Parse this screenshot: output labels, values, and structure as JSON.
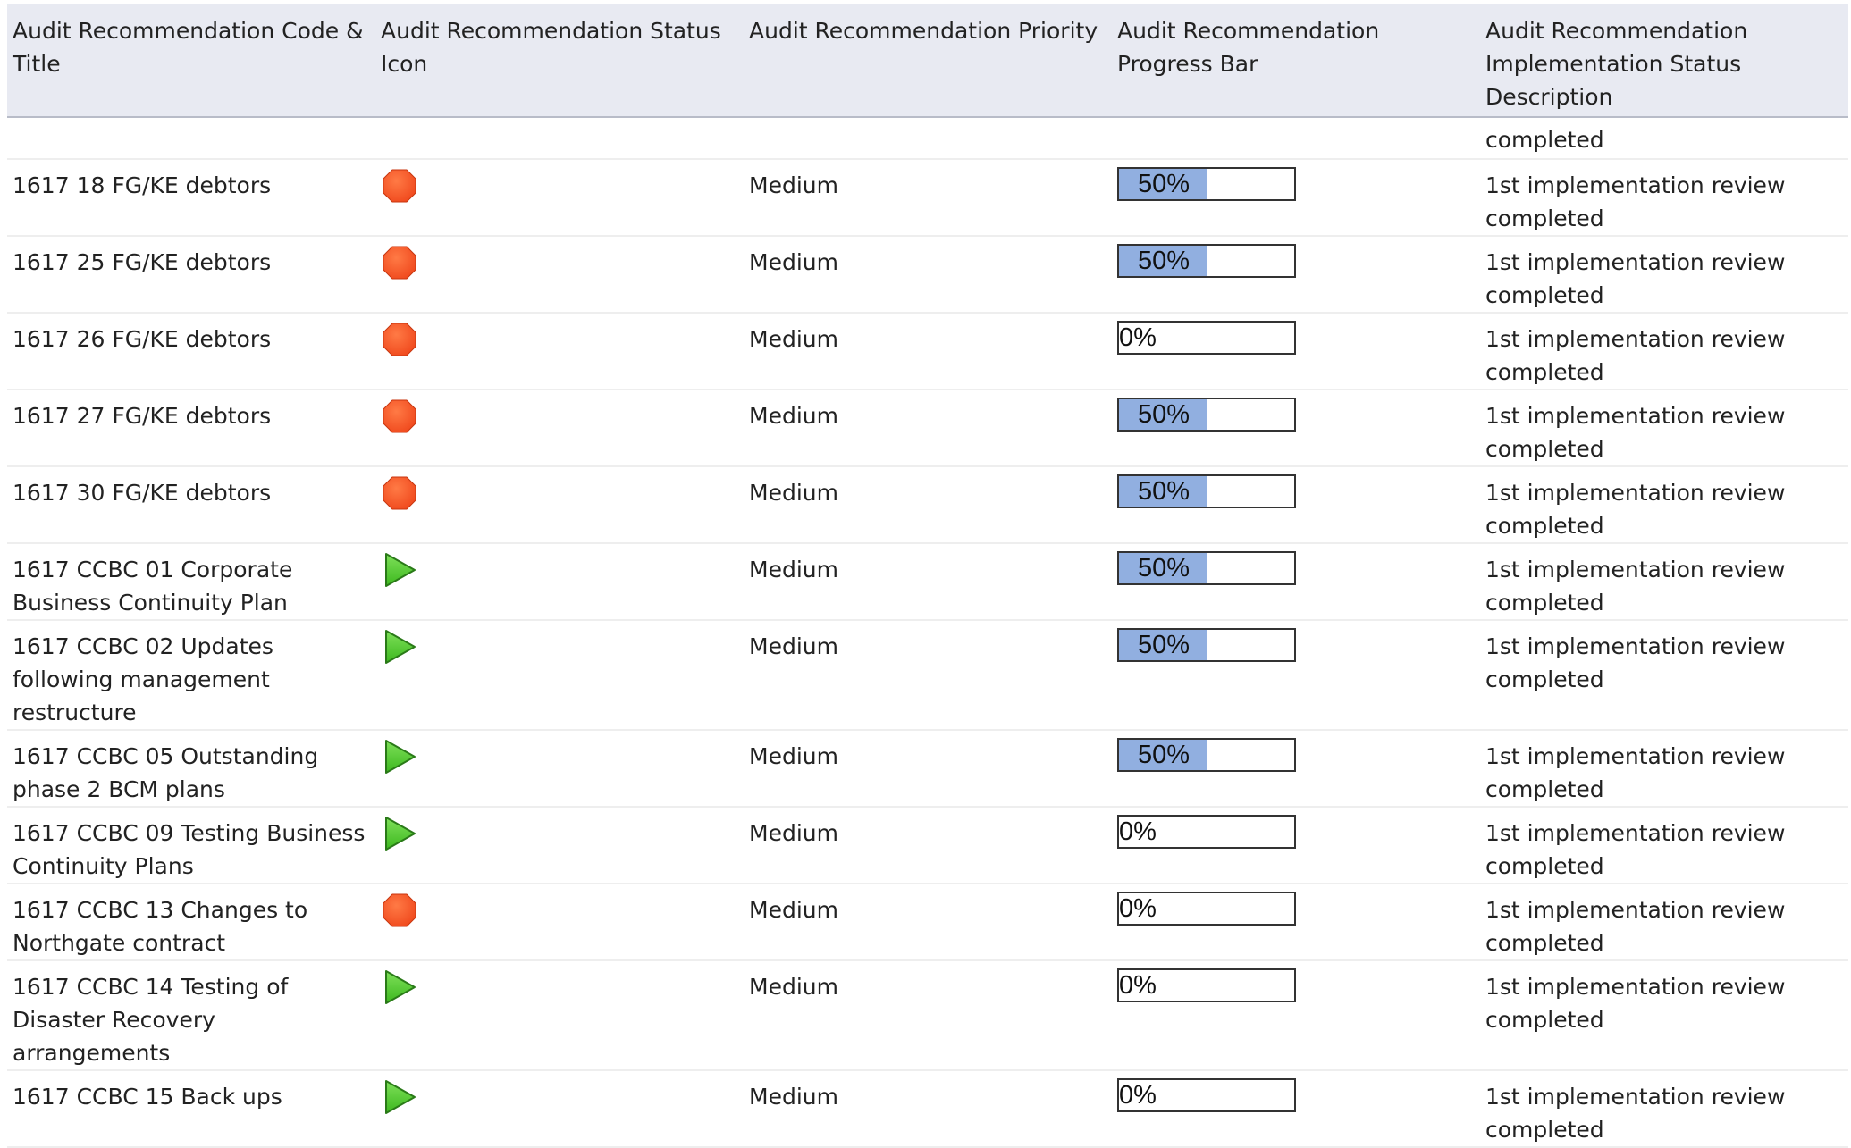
{
  "table": {
    "headers": [
      "Audit Recommendation Code & Title",
      "Audit Recommendation Status Icon",
      "Audit Recommendation Priority",
      "Audit Recommendation Progress Bar",
      "Audit Recommendation Implementation Status Description"
    ],
    "partial_row_description": "completed",
    "rows": [
      {
        "title": "1617 18 FG/KE debtors",
        "status_icon": "red-octagon-icon",
        "priority": "Medium",
        "progress": 50,
        "progress_label": "50%",
        "description": "1st implementation review completed"
      },
      {
        "title": "1617 25 FG/KE debtors",
        "status_icon": "red-octagon-icon",
        "priority": "Medium",
        "progress": 50,
        "progress_label": "50%",
        "description": "1st implementation review completed"
      },
      {
        "title": "1617 26 FG/KE debtors",
        "status_icon": "red-octagon-icon",
        "priority": "Medium",
        "progress": 0,
        "progress_label": "0%",
        "description": "1st implementation review completed"
      },
      {
        "title": "1617 27 FG/KE debtors",
        "status_icon": "red-octagon-icon",
        "priority": "Medium",
        "progress": 50,
        "progress_label": "50%",
        "description": "1st implementation review completed"
      },
      {
        "title": "1617 30 FG/KE debtors",
        "status_icon": "red-octagon-icon",
        "priority": "Medium",
        "progress": 50,
        "progress_label": "50%",
        "description": "1st implementation review completed"
      },
      {
        "title": "1617 CCBC 01 Corporate Business Continuity Plan",
        "status_icon": "green-play-icon",
        "priority": "Medium",
        "progress": 50,
        "progress_label": "50%",
        "description": "1st implementation review completed"
      },
      {
        "title": "1617 CCBC 02 Updates following management restructure",
        "status_icon": "green-play-icon",
        "priority": "Medium",
        "progress": 50,
        "progress_label": "50%",
        "description": "1st implementation review completed"
      },
      {
        "title": "1617 CCBC 05 Outstanding phase 2 BCM plans",
        "status_icon": "green-play-icon",
        "priority": "Medium",
        "progress": 50,
        "progress_label": "50%",
        "description": "1st implementation review completed"
      },
      {
        "title": "1617 CCBC 09 Testing Business Continuity Plans",
        "status_icon": "green-play-icon",
        "priority": "Medium",
        "progress": 0,
        "progress_label": "0%",
        "description": "1st implementation review completed"
      },
      {
        "title": "1617 CCBC 13 Changes to Northgate contract",
        "status_icon": "red-octagon-icon",
        "priority": "Medium",
        "progress": 0,
        "progress_label": "0%",
        "description": "1st implementation review completed"
      },
      {
        "title": "1617 CCBC 14 Testing of Disaster Recovery arrangements",
        "status_icon": "green-play-icon",
        "priority": "Medium",
        "progress": 0,
        "progress_label": "0%",
        "description": "1st implementation review completed"
      },
      {
        "title": "1617 CCBC 15 Back ups",
        "status_icon": "green-play-icon",
        "priority": "Medium",
        "progress": 0,
        "progress_label": "0%",
        "description": "1st implementation review completed"
      }
    ]
  },
  "colors": {
    "header_bg": "#e8eaf2",
    "progress_fill": "#91afe0",
    "status_red": "#f04a1e",
    "status_green": "#3cb81e"
  }
}
